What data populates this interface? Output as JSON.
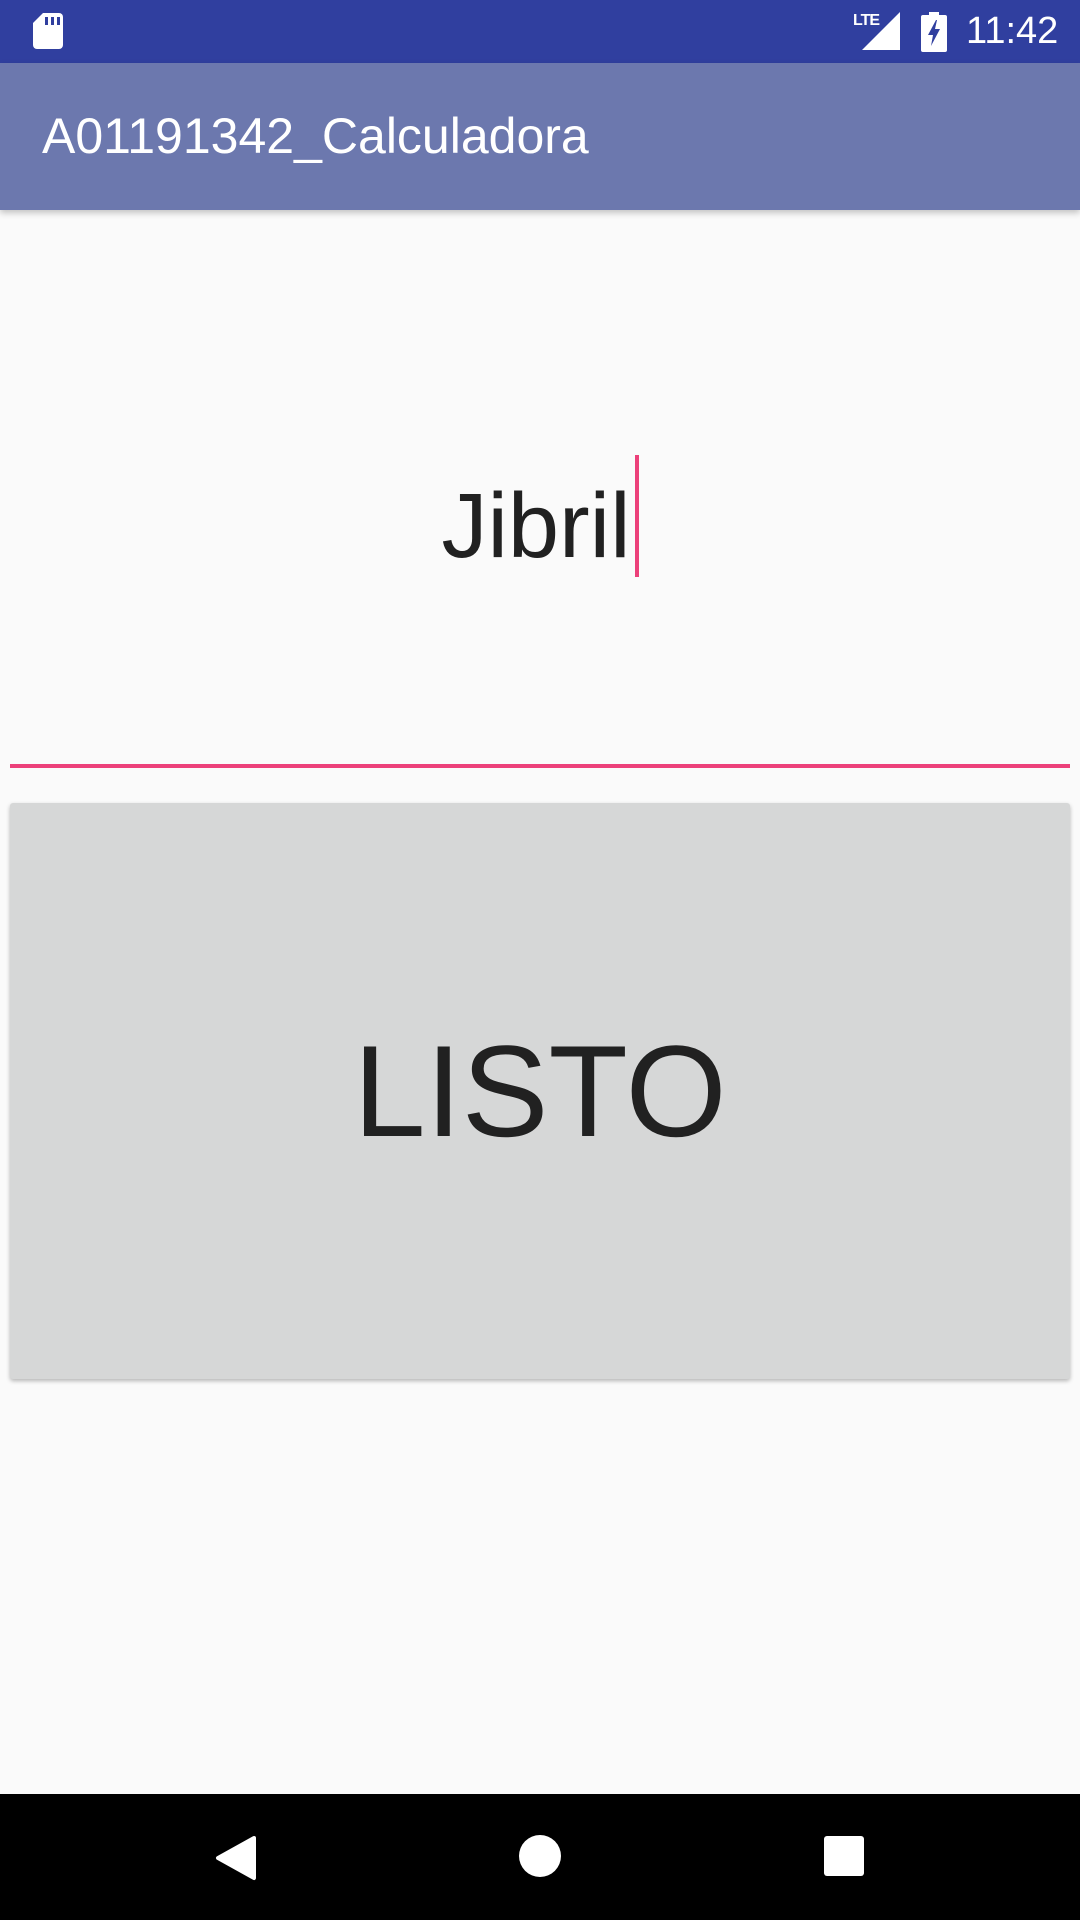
{
  "status_bar": {
    "network": "LTE",
    "time": "11:42",
    "icons": [
      "sd-card-icon",
      "lte-signal-icon",
      "battery-charging-icon"
    ]
  },
  "app_bar": {
    "title": "A01191342_Calculadora"
  },
  "form": {
    "name_value": "Jibril",
    "button_label": "LISTO"
  },
  "nav_bar": {
    "icons": [
      "back-icon",
      "home-icon",
      "recents-icon"
    ]
  },
  "colors": {
    "status_bar": "#303f9f",
    "app_bar": "#6c78ae",
    "accent": "#ec407a",
    "button": "#d6d7d7",
    "background": "#fafafa"
  }
}
